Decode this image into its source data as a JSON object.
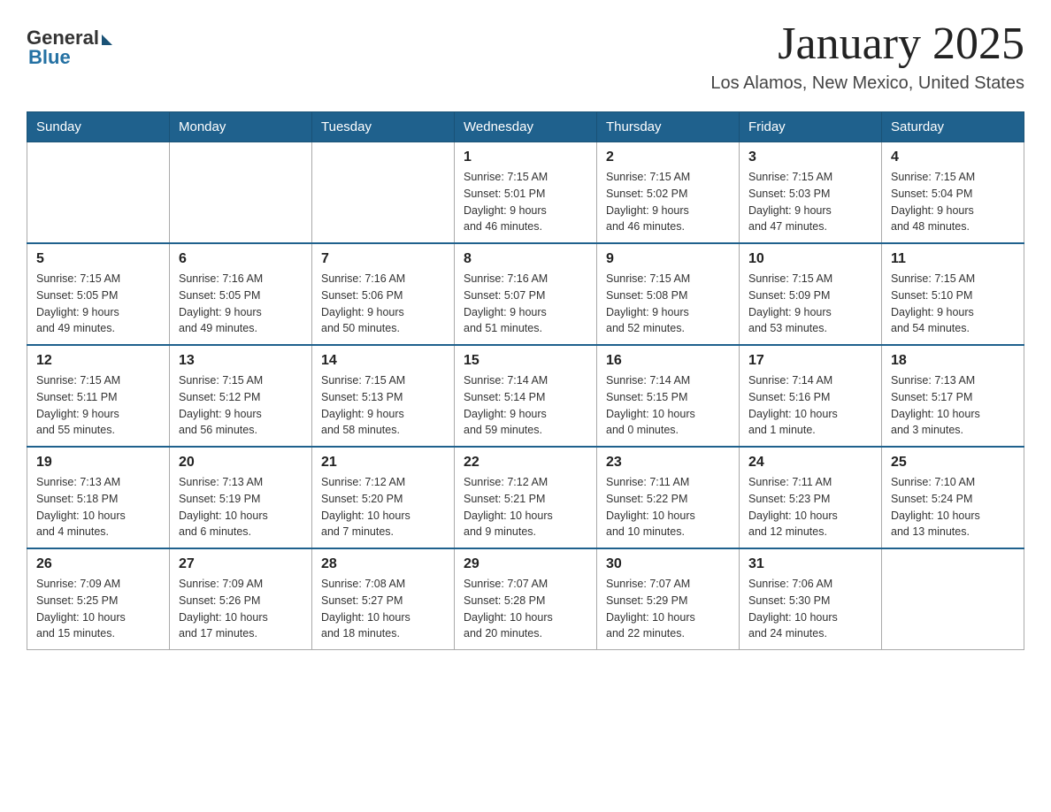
{
  "header": {
    "logo_general": "General",
    "logo_blue": "Blue",
    "month_title": "January 2025",
    "location": "Los Alamos, New Mexico, United States"
  },
  "weekdays": [
    "Sunday",
    "Monday",
    "Tuesday",
    "Wednesday",
    "Thursday",
    "Friday",
    "Saturday"
  ],
  "weeks": [
    [
      {
        "day": "",
        "info": ""
      },
      {
        "day": "",
        "info": ""
      },
      {
        "day": "",
        "info": ""
      },
      {
        "day": "1",
        "info": "Sunrise: 7:15 AM\nSunset: 5:01 PM\nDaylight: 9 hours\nand 46 minutes."
      },
      {
        "day": "2",
        "info": "Sunrise: 7:15 AM\nSunset: 5:02 PM\nDaylight: 9 hours\nand 46 minutes."
      },
      {
        "day": "3",
        "info": "Sunrise: 7:15 AM\nSunset: 5:03 PM\nDaylight: 9 hours\nand 47 minutes."
      },
      {
        "day": "4",
        "info": "Sunrise: 7:15 AM\nSunset: 5:04 PM\nDaylight: 9 hours\nand 48 minutes."
      }
    ],
    [
      {
        "day": "5",
        "info": "Sunrise: 7:15 AM\nSunset: 5:05 PM\nDaylight: 9 hours\nand 49 minutes."
      },
      {
        "day": "6",
        "info": "Sunrise: 7:16 AM\nSunset: 5:05 PM\nDaylight: 9 hours\nand 49 minutes."
      },
      {
        "day": "7",
        "info": "Sunrise: 7:16 AM\nSunset: 5:06 PM\nDaylight: 9 hours\nand 50 minutes."
      },
      {
        "day": "8",
        "info": "Sunrise: 7:16 AM\nSunset: 5:07 PM\nDaylight: 9 hours\nand 51 minutes."
      },
      {
        "day": "9",
        "info": "Sunrise: 7:15 AM\nSunset: 5:08 PM\nDaylight: 9 hours\nand 52 minutes."
      },
      {
        "day": "10",
        "info": "Sunrise: 7:15 AM\nSunset: 5:09 PM\nDaylight: 9 hours\nand 53 minutes."
      },
      {
        "day": "11",
        "info": "Sunrise: 7:15 AM\nSunset: 5:10 PM\nDaylight: 9 hours\nand 54 minutes."
      }
    ],
    [
      {
        "day": "12",
        "info": "Sunrise: 7:15 AM\nSunset: 5:11 PM\nDaylight: 9 hours\nand 55 minutes."
      },
      {
        "day": "13",
        "info": "Sunrise: 7:15 AM\nSunset: 5:12 PM\nDaylight: 9 hours\nand 56 minutes."
      },
      {
        "day": "14",
        "info": "Sunrise: 7:15 AM\nSunset: 5:13 PM\nDaylight: 9 hours\nand 58 minutes."
      },
      {
        "day": "15",
        "info": "Sunrise: 7:14 AM\nSunset: 5:14 PM\nDaylight: 9 hours\nand 59 minutes."
      },
      {
        "day": "16",
        "info": "Sunrise: 7:14 AM\nSunset: 5:15 PM\nDaylight: 10 hours\nand 0 minutes."
      },
      {
        "day": "17",
        "info": "Sunrise: 7:14 AM\nSunset: 5:16 PM\nDaylight: 10 hours\nand 1 minute."
      },
      {
        "day": "18",
        "info": "Sunrise: 7:13 AM\nSunset: 5:17 PM\nDaylight: 10 hours\nand 3 minutes."
      }
    ],
    [
      {
        "day": "19",
        "info": "Sunrise: 7:13 AM\nSunset: 5:18 PM\nDaylight: 10 hours\nand 4 minutes."
      },
      {
        "day": "20",
        "info": "Sunrise: 7:13 AM\nSunset: 5:19 PM\nDaylight: 10 hours\nand 6 minutes."
      },
      {
        "day": "21",
        "info": "Sunrise: 7:12 AM\nSunset: 5:20 PM\nDaylight: 10 hours\nand 7 minutes."
      },
      {
        "day": "22",
        "info": "Sunrise: 7:12 AM\nSunset: 5:21 PM\nDaylight: 10 hours\nand 9 minutes."
      },
      {
        "day": "23",
        "info": "Sunrise: 7:11 AM\nSunset: 5:22 PM\nDaylight: 10 hours\nand 10 minutes."
      },
      {
        "day": "24",
        "info": "Sunrise: 7:11 AM\nSunset: 5:23 PM\nDaylight: 10 hours\nand 12 minutes."
      },
      {
        "day": "25",
        "info": "Sunrise: 7:10 AM\nSunset: 5:24 PM\nDaylight: 10 hours\nand 13 minutes."
      }
    ],
    [
      {
        "day": "26",
        "info": "Sunrise: 7:09 AM\nSunset: 5:25 PM\nDaylight: 10 hours\nand 15 minutes."
      },
      {
        "day": "27",
        "info": "Sunrise: 7:09 AM\nSunset: 5:26 PM\nDaylight: 10 hours\nand 17 minutes."
      },
      {
        "day": "28",
        "info": "Sunrise: 7:08 AM\nSunset: 5:27 PM\nDaylight: 10 hours\nand 18 minutes."
      },
      {
        "day": "29",
        "info": "Sunrise: 7:07 AM\nSunset: 5:28 PM\nDaylight: 10 hours\nand 20 minutes."
      },
      {
        "day": "30",
        "info": "Sunrise: 7:07 AM\nSunset: 5:29 PM\nDaylight: 10 hours\nand 22 minutes."
      },
      {
        "day": "31",
        "info": "Sunrise: 7:06 AM\nSunset: 5:30 PM\nDaylight: 10 hours\nand 24 minutes."
      },
      {
        "day": "",
        "info": ""
      }
    ]
  ]
}
